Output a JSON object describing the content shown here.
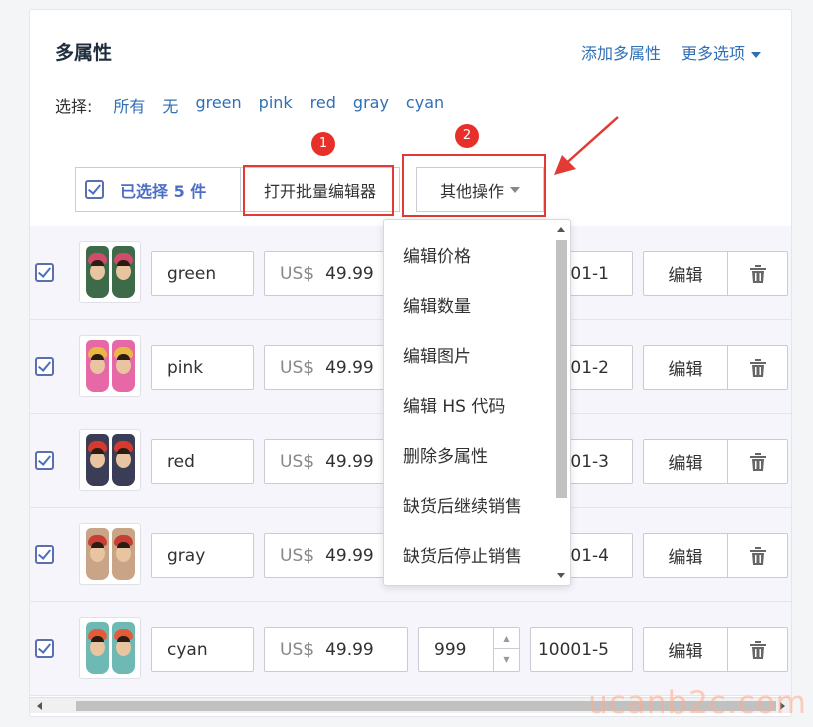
{
  "section": {
    "title": "多属性",
    "add_link": "添加多属性",
    "more_link": "更多选项"
  },
  "select": {
    "label": "选择:",
    "options": [
      "所有",
      "无",
      "green",
      "pink",
      "red",
      "gray",
      "cyan"
    ]
  },
  "annotations": {
    "badge_1": "1",
    "badge_2": "2",
    "highlight_color": "#e23a34"
  },
  "bulk": {
    "selected_text": "已选择 5 件",
    "open_editor": "打开批量编辑器",
    "other_ops": "其他操作"
  },
  "dropdown": {
    "items": [
      "编辑价格",
      "编辑数量",
      "编辑图片",
      "编辑 HS 代码",
      "删除多属性",
      "缺货后继续销售",
      "缺货后停止销售"
    ]
  },
  "variants": [
    {
      "name": "green",
      "currency": "US$",
      "price": "49.99",
      "qty": "",
      "sku": "001-1",
      "edit": "编辑",
      "bg": "#3d6b4a",
      "flower": "#d14b6a"
    },
    {
      "name": "pink",
      "currency": "US$",
      "price": "49.99",
      "qty": "",
      "sku": "001-2",
      "edit": "编辑",
      "bg": "#e768a6",
      "flower": "#e9b843"
    },
    {
      "name": "red",
      "currency": "US$",
      "price": "49.99",
      "qty": "",
      "sku": "001-3",
      "edit": "编辑",
      "bg": "#3a3d55",
      "flower": "#d8392f"
    },
    {
      "name": "gray",
      "currency": "US$",
      "price": "49.99",
      "qty": "",
      "sku": "001-4",
      "edit": "编辑",
      "bg": "#c9a487",
      "flower": "#c83d36"
    },
    {
      "name": "cyan",
      "currency": "US$",
      "price": "49.99",
      "qty": "999",
      "sku": "10001-5",
      "edit": "编辑",
      "bg": "#6fb9b5",
      "flower": "#e25c3a"
    }
  ],
  "watermark": "ucanb2c.com"
}
